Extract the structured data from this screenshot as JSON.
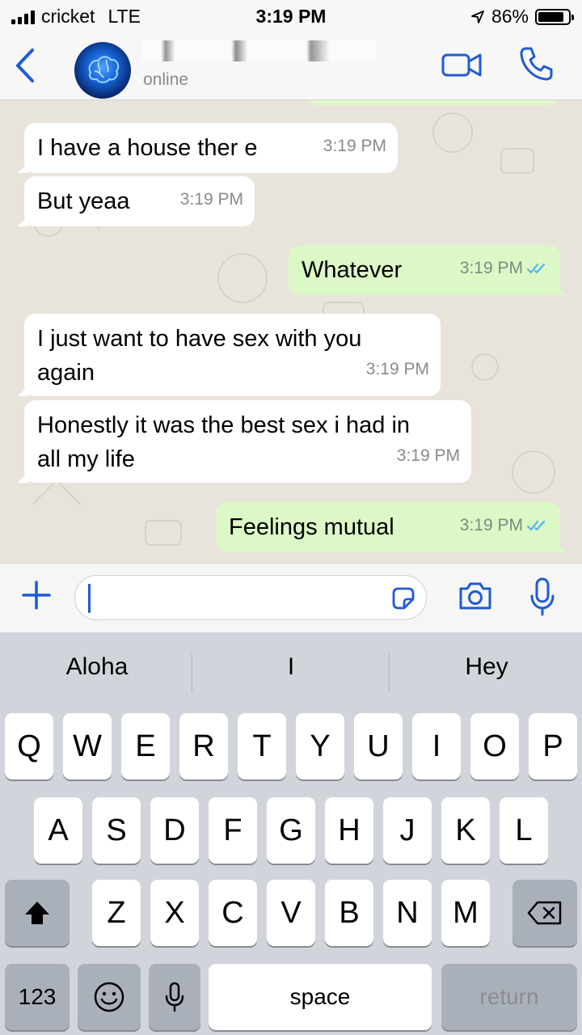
{
  "status": {
    "carrier": "cricket",
    "network": "LTE",
    "time": "3:19 PM",
    "battery": "86%",
    "battery_level": 0.86
  },
  "header": {
    "contact_status": "online",
    "back_icon": "chevron-left-icon",
    "video_icon": "video-call-icon",
    "phone_icon": "phone-icon"
  },
  "messages": [
    {
      "dir": "in",
      "text": "I have a house ther e",
      "time": "3:19 PM"
    },
    {
      "dir": "in",
      "text": "But yeaa",
      "time": "3:19 PM"
    },
    {
      "dir": "out",
      "text": "Whatever",
      "time": "3:19 PM",
      "read": true
    },
    {
      "dir": "in",
      "line1": "I just want to have sex with you",
      "line2": "again",
      "time": "3:19 PM"
    },
    {
      "dir": "in",
      "line1": "Honestly it was the best sex i had in",
      "line2": "all my life",
      "time": "3:19 PM"
    },
    {
      "dir": "out",
      "text": "Feelings mutual",
      "time": "3:19 PM",
      "read": true
    }
  ],
  "input": {
    "value": ""
  },
  "suggestions": [
    "Aloha",
    "I",
    "Hey"
  ],
  "keys": {
    "row1": [
      "Q",
      "W",
      "E",
      "R",
      "T",
      "Y",
      "U",
      "I",
      "O",
      "P"
    ],
    "row2": [
      "A",
      "S",
      "D",
      "F",
      "G",
      "H",
      "J",
      "K",
      "L"
    ],
    "row3": [
      "Z",
      "X",
      "C",
      "V",
      "B",
      "N",
      "M"
    ],
    "numbers": "123",
    "space": "space",
    "return": "return"
  },
  "colors": {
    "accent": "#1f5bd6",
    "outgoing_bubble": "#dcf8c6",
    "incoming_bubble": "#ffffff",
    "read_ticks": "#4fb6ec"
  }
}
